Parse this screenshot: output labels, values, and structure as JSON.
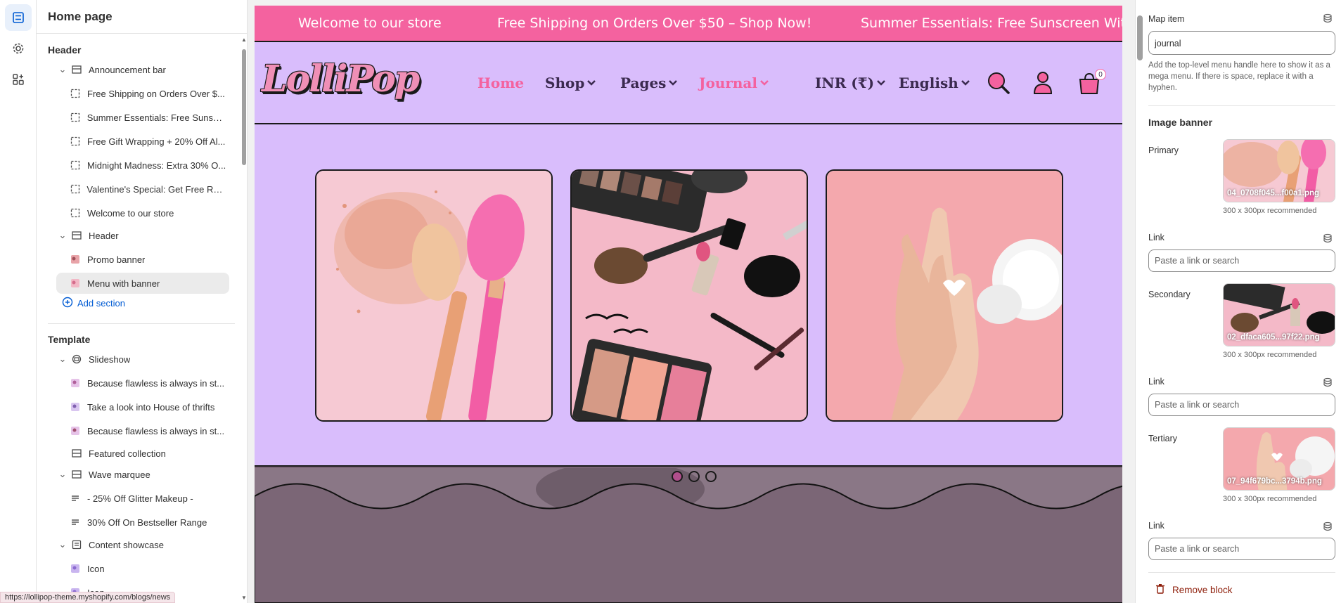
{
  "sidebar": {
    "title": "Home page",
    "header_group": "Header",
    "announcement_bar": "Announcement bar",
    "announcements": [
      "Free Shipping on Orders Over $...",
      "Summer Essentials: Free Sunscr...",
      "Free Gift Wrapping + 20% Off Al...",
      "Midnight Madness: Extra 30% O...",
      "Valentine's Special: Get Free Ros...",
      "Welcome to our store"
    ],
    "header_section": "Header",
    "header_blocks": [
      "Promo banner",
      "Menu with banner"
    ],
    "add_section": "Add section",
    "template_group": "Template",
    "slideshow": "Slideshow",
    "slides": [
      "Because flawless is always in st...",
      "Take a look into House of thrifts",
      "Because flawless is always in st..."
    ],
    "featured_collection": "Featured collection",
    "wave_marquee": "Wave marquee",
    "marquee_items": [
      "- 25% Off Glitter Makeup -",
      "30% Off On Bestseller Range"
    ],
    "content_showcase": "Content showcase",
    "showcase_items": [
      "Icon",
      "Icon"
    ]
  },
  "status_url": "https://lollipop-theme.myshopify.com/blogs/news",
  "preview": {
    "announcements": [
      "Welcome to our store",
      "Free Shipping on Orders Over $50 – Shop Now!",
      "Summer Essentials: Free Sunscreen With O"
    ],
    "logo": "LolliPop",
    "nav": [
      "Home",
      "Shop",
      "Pages",
      "Journal"
    ],
    "currency": "INR (₹)",
    "language": "English",
    "cart_count": "0",
    "colors": {
      "announcement": "#f4629f",
      "header": "#d9bdfc",
      "nav_active": "#f4629f"
    }
  },
  "panel": {
    "map_item_label": "Map item",
    "map_item_value": "journal",
    "map_item_help": "Add the top-level menu handle here to show it as a mega menu. If there is space, replace it with a hyphen.",
    "image_banner_title": "Image banner",
    "primary_label": "Primary",
    "primary_file": "04_0708f045...f00a1.png",
    "secondary_label": "Secondary",
    "secondary_file": "02_dfaca605...97f22.png",
    "tertiary_label": "Tertiary",
    "tertiary_file": "07_94f679bc...3794b.png",
    "recommended": "300 x 300px recommended",
    "link_label": "Link",
    "link_placeholder": "Paste a link or search",
    "remove_block": "Remove block"
  }
}
